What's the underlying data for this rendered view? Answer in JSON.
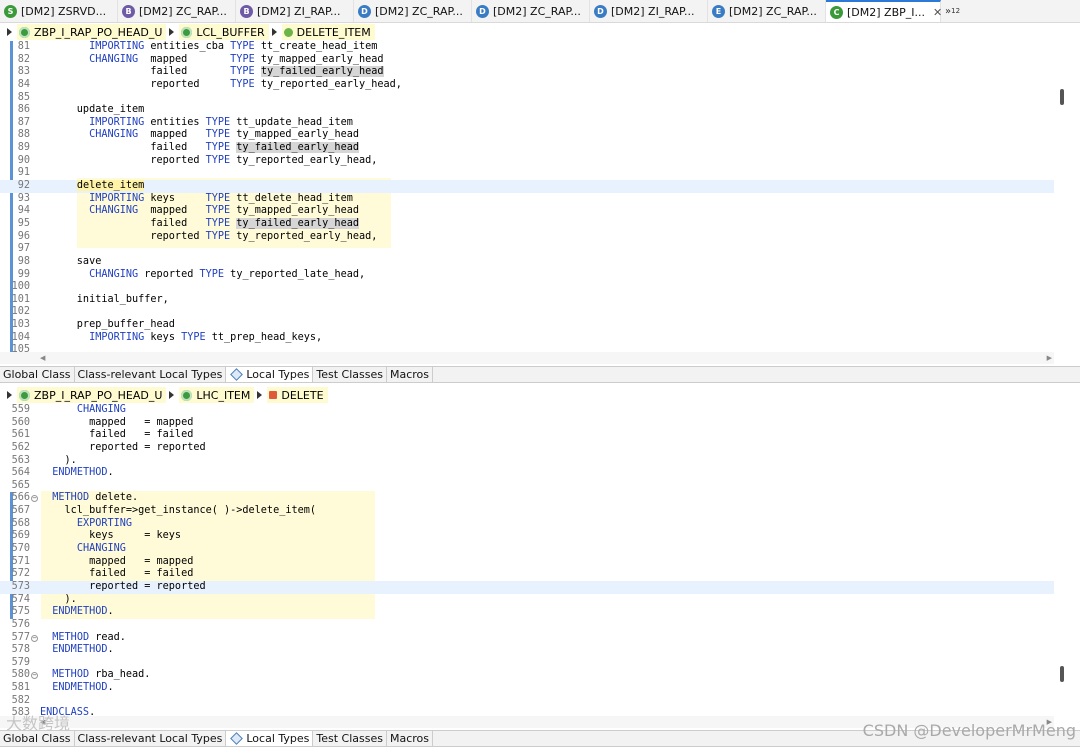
{
  "tabs": [
    {
      "label": "[DM2] ZSRVD...",
      "icon": "green-service-icon",
      "color": "#3a9a3a",
      "glyph": "S"
    },
    {
      "label": "[DM2] ZC_RAP...",
      "icon": "behavior-icon",
      "color": "#6f5aa6",
      "glyph": "B"
    },
    {
      "label": "[DM2] ZI_RAP...",
      "icon": "behavior-icon",
      "color": "#6f5aa6",
      "glyph": "B"
    },
    {
      "label": "[DM2] ZC_RAP...",
      "icon": "cds-view-icon",
      "color": "#3a7cc4",
      "glyph": "D"
    },
    {
      "label": "[DM2] ZC_RAP...",
      "icon": "cds-view-icon",
      "color": "#3a7cc4",
      "glyph": "D"
    },
    {
      "label": "[DM2] ZI_RAP...",
      "icon": "cds-view-icon",
      "color": "#3a7cc4",
      "glyph": "D"
    },
    {
      "label": "[DM2] ZC_RAP...",
      "icon": "metadata-extension-icon",
      "color": "#3a7cc4",
      "glyph": "E"
    },
    {
      "label": "[DM2] ZBP_I...",
      "icon": "class-icon",
      "color": "#3a9a3a",
      "glyph": "C",
      "active": true
    }
  ],
  "tab_overflow": {
    "label": "»",
    "count": "12"
  },
  "top_crumb": {
    "class": "ZBP_I_RAP_PO_HEAD_U",
    "local_class": "LCL_BUFFER",
    "method": "DELETE_ITEM"
  },
  "bottom_crumb": {
    "class": "ZBP_I_RAP_PO_HEAD_U",
    "local_class": "LHC_ITEM",
    "method": "DELETE"
  },
  "part_tabs": [
    {
      "label": "Global Class"
    },
    {
      "label": "Class-relevant Local Types"
    },
    {
      "label": "Local Types",
      "active": true
    },
    {
      "label": "Test Classes"
    },
    {
      "label": "Macros"
    }
  ],
  "top_code": [
    {
      "n": "81",
      "t": "        IMPORTING entities_cba TYPE tt_create_head_item"
    },
    {
      "n": "82",
      "t": "        CHANGING  mapped       TYPE ty_mapped_early_head"
    },
    {
      "n": "83",
      "t": "                  failed       TYPE ty_failed_early_head"
    },
    {
      "n": "84",
      "t": "                  reported     TYPE ty_reported_early_head,"
    },
    {
      "n": "85",
      "t": ""
    },
    {
      "n": "86",
      "t": "      update_item"
    },
    {
      "n": "87",
      "t": "        IMPORTING entities TYPE tt_update_head_item"
    },
    {
      "n": "88",
      "t": "        CHANGING  mapped   TYPE ty_mapped_early_head"
    },
    {
      "n": "89",
      "t": "                  failed   TYPE ty_failed_early_head"
    },
    {
      "n": "90",
      "t": "                  reported TYPE ty_reported_early_head,"
    },
    {
      "n": "91",
      "t": ""
    },
    {
      "n": "92",
      "t": "      delete_item"
    },
    {
      "n": "93",
      "t": "        IMPORTING keys     TYPE tt_delete_head_item"
    },
    {
      "n": "94",
      "t": "        CHANGING  mapped   TYPE ty_mapped_early_head"
    },
    {
      "n": "95",
      "t": "                  failed   TYPE ty_failed_early_head"
    },
    {
      "n": "96",
      "t": "                  reported TYPE ty_reported_early_head,"
    },
    {
      "n": "97",
      "t": ""
    },
    {
      "n": "98",
      "t": "      save"
    },
    {
      "n": "99",
      "t": "        CHANGING reported TYPE ty_reported_late_head,"
    },
    {
      "n": "100",
      "t": ""
    },
    {
      "n": "101",
      "t": "      initial_buffer,"
    },
    {
      "n": "102",
      "t": ""
    },
    {
      "n": "103",
      "t": "      prep_buffer_head"
    },
    {
      "n": "104",
      "t": "        IMPORTING keys TYPE tt_prep_head_keys,"
    },
    {
      "n": "105",
      "t": ""
    }
  ],
  "bottom_code": [
    {
      "n": "559",
      "t": "      CHANGING"
    },
    {
      "n": "560",
      "t": "        mapped   = mapped"
    },
    {
      "n": "561",
      "t": "        failed   = failed"
    },
    {
      "n": "562",
      "t": "        reported = reported"
    },
    {
      "n": "563",
      "t": "    )."
    },
    {
      "n": "564",
      "t": "  ENDMETHOD."
    },
    {
      "n": "565",
      "t": ""
    },
    {
      "n": "566",
      "t": "  METHOD delete."
    },
    {
      "n": "567",
      "t": "    lcl_buffer=>get_instance( )->delete_item("
    },
    {
      "n": "568",
      "t": "      EXPORTING"
    },
    {
      "n": "569",
      "t": "        keys     = keys"
    },
    {
      "n": "570",
      "t": "      CHANGING"
    },
    {
      "n": "571",
      "t": "        mapped   = mapped"
    },
    {
      "n": "572",
      "t": "        failed   = failed"
    },
    {
      "n": "573",
      "t": "        reported = reported"
    },
    {
      "n": "574",
      "t": "    )."
    },
    {
      "n": "575",
      "t": "  ENDMETHOD."
    },
    {
      "n": "576",
      "t": ""
    },
    {
      "n": "577",
      "t": "  METHOD read."
    },
    {
      "n": "578",
      "t": "  ENDMETHOD."
    },
    {
      "n": "579",
      "t": ""
    },
    {
      "n": "580",
      "t": "  METHOD rba_head."
    },
    {
      "n": "581",
      "t": "  ENDMETHOD."
    },
    {
      "n": "582",
      "t": ""
    },
    {
      "n": "583",
      "t": "ENDCLASS."
    }
  ],
  "keywords": [
    "IMPORTING",
    "CHANGING",
    "TYPE",
    "EXPORTING",
    "METHOD",
    "ENDMETHOD",
    "ENDCLASS"
  ],
  "watermark": "CSDN @DeveloperMrMeng",
  "watermark2": "大数跨境"
}
